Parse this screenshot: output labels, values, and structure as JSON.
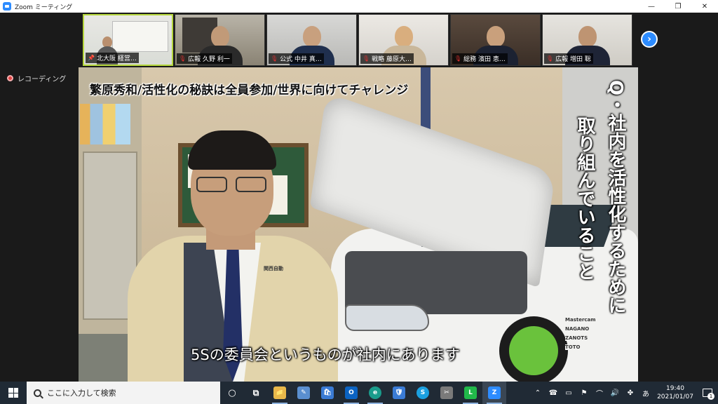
{
  "window": {
    "title": "Zoom ミーティング",
    "minimize": "—",
    "restore": "❐",
    "close": "✕"
  },
  "recording": {
    "label": "レコーディング"
  },
  "participants": [
    {
      "name": "北大阪 経営…",
      "pinned": true,
      "muted": false,
      "active": true
    },
    {
      "name": "広報 久野 利一",
      "pinned": false,
      "muted": true,
      "active": false
    },
    {
      "name": "公式 中井 真…",
      "pinned": false,
      "muted": true,
      "active": false
    },
    {
      "name": "戦略 藤原大…",
      "pinned": false,
      "muted": true,
      "active": false
    },
    {
      "name": "総務 濱田 恵…",
      "pinned": false,
      "muted": true,
      "active": false
    },
    {
      "name": "広報 増田 聡",
      "pinned": false,
      "muted": true,
      "active": false
    }
  ],
  "next_button": {
    "icon": "chevron-right-icon",
    "glyph": "›"
  },
  "video": {
    "title_caption": "繁原秀和/活性化の秘訣は全員参加/世界に向けてチャレンジ",
    "question_line1": "Q・社内を活性化するために",
    "question_line2": "取り組んでいること",
    "subtitle": "5Sの委員会というものが社内にあります",
    "jacket_label": "関西自動",
    "sponsors": [
      "Mastercam",
      "NAGANO",
      "ZANOTS",
      "TOTO"
    ]
  },
  "taskbar": {
    "search_placeholder": "ここに入力して検索",
    "apps": [
      {
        "name": "cortana",
        "glyph": "○",
        "color": "#202a35"
      },
      {
        "name": "task-view",
        "glyph": "⧉",
        "color": "#202a35"
      },
      {
        "name": "file-explorer",
        "glyph": "📁",
        "color": "#e8b84a"
      },
      {
        "name": "paint",
        "glyph": "✎",
        "color": "#5a8fd0"
      },
      {
        "name": "store",
        "glyph": "🛍",
        "color": "#3a7bd5"
      },
      {
        "name": "outlook",
        "glyph": "O",
        "color": "#0b63c2"
      },
      {
        "name": "edge",
        "glyph": "e",
        "color": "#1a9c8c"
      },
      {
        "name": "security",
        "glyph": "🛡",
        "color": "#3a7bd5"
      },
      {
        "name": "skype",
        "glyph": "S",
        "color": "#1ba0e0"
      },
      {
        "name": "snip",
        "glyph": "✂",
        "color": "#7a7a7a"
      },
      {
        "name": "line",
        "glyph": "L",
        "color": "#21b94a"
      },
      {
        "name": "zoom",
        "glyph": "Z",
        "color": "#2d8cff"
      }
    ],
    "tray": [
      "⌃",
      "☎",
      "▭",
      "⚑",
      "⌒",
      "🔊",
      "✤",
      "あ"
    ],
    "time": "19:40",
    "date": "2021/01/07",
    "notifications": "1"
  }
}
